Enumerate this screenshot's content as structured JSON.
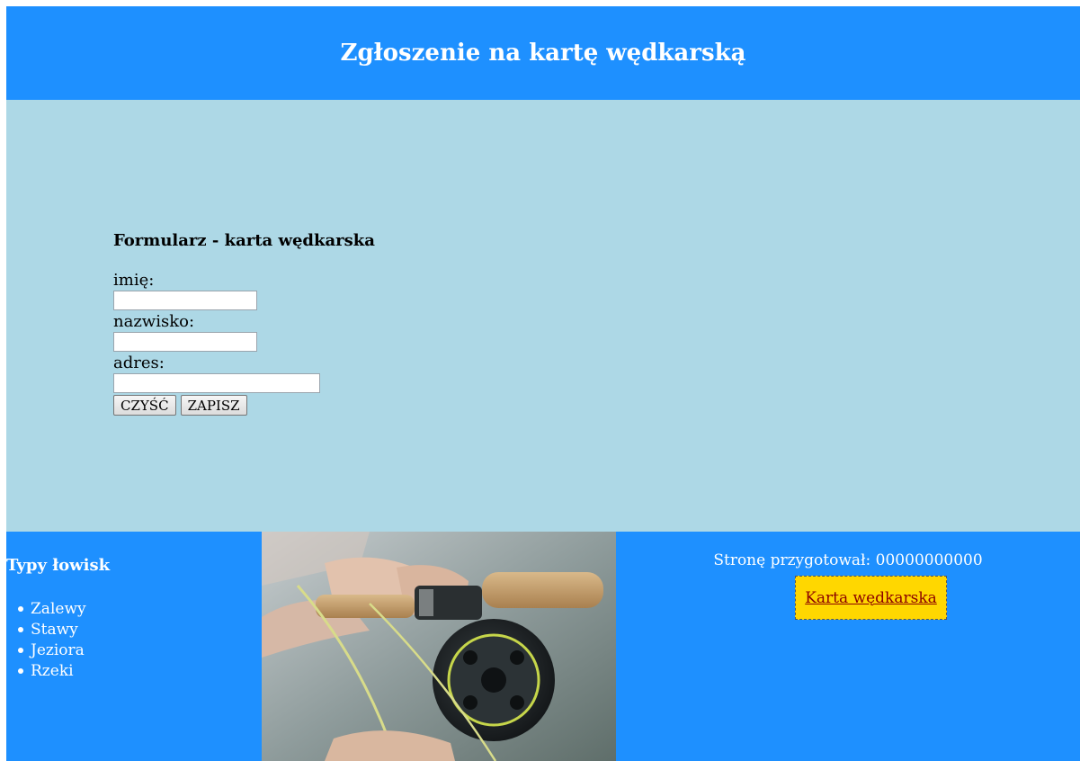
{
  "header": {
    "title": "Zgłoszenie na kartę wędkarską"
  },
  "form": {
    "heading": "Formularz - karta wędkarska",
    "fields": [
      {
        "label": "imię:",
        "value": ""
      },
      {
        "label": "nazwisko:",
        "value": ""
      },
      {
        "label": "adres:",
        "value": ""
      }
    ],
    "clear_button": "CZYŚĆ",
    "save_button": "ZAPISZ"
  },
  "footer_left": {
    "heading": "Typy łowisk",
    "items": [
      "Zalewy",
      "Stawy",
      "Jeziora",
      "Rzeki"
    ]
  },
  "footer_right": {
    "author": "Stronę przygotował: 00000000000",
    "link": "Karta wędkarska"
  },
  "colors": {
    "header_bg": "#1e90ff",
    "main_bg": "#add8e6",
    "link_box_bg": "#ffd700",
    "link_text": "#8b0000"
  },
  "photo": {
    "icon": "fishing-reel-photo"
  }
}
